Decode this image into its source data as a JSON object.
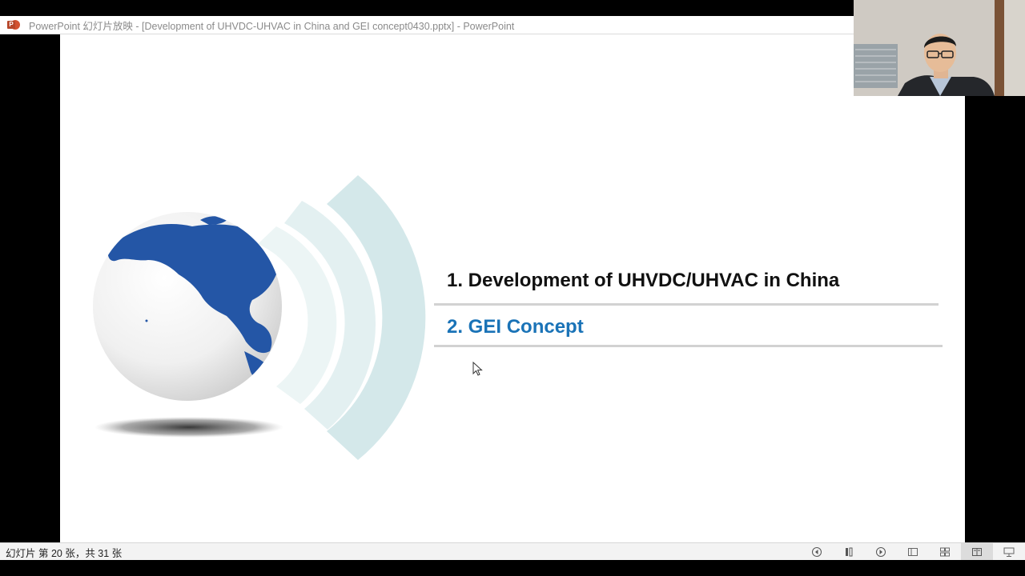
{
  "window": {
    "title": "PowerPoint 幻灯片放映 - [Development of UHVDC-UHVAC in China and GEI concept0430.pptx] - PowerPoint",
    "app_icon": "powerpoint-icon"
  },
  "slide": {
    "items": [
      {
        "label": "1. Development of UHVDC/UHVAC in China",
        "color": "#111111"
      },
      {
        "label": "2. GEI Concept",
        "color": "#1a73b7"
      }
    ],
    "graphic": "globe-illustration"
  },
  "statusbar": {
    "slide_info": "幻灯片 第 20 张，共 31 张",
    "icons": [
      "prev-slide-icon",
      "pause-icon",
      "next-slide-icon",
      "normal-view-icon",
      "slide-sorter-icon",
      "reading-view-icon",
      "slideshow-icon"
    ]
  },
  "webcam": {
    "description_icon": "presenter-webcam"
  }
}
